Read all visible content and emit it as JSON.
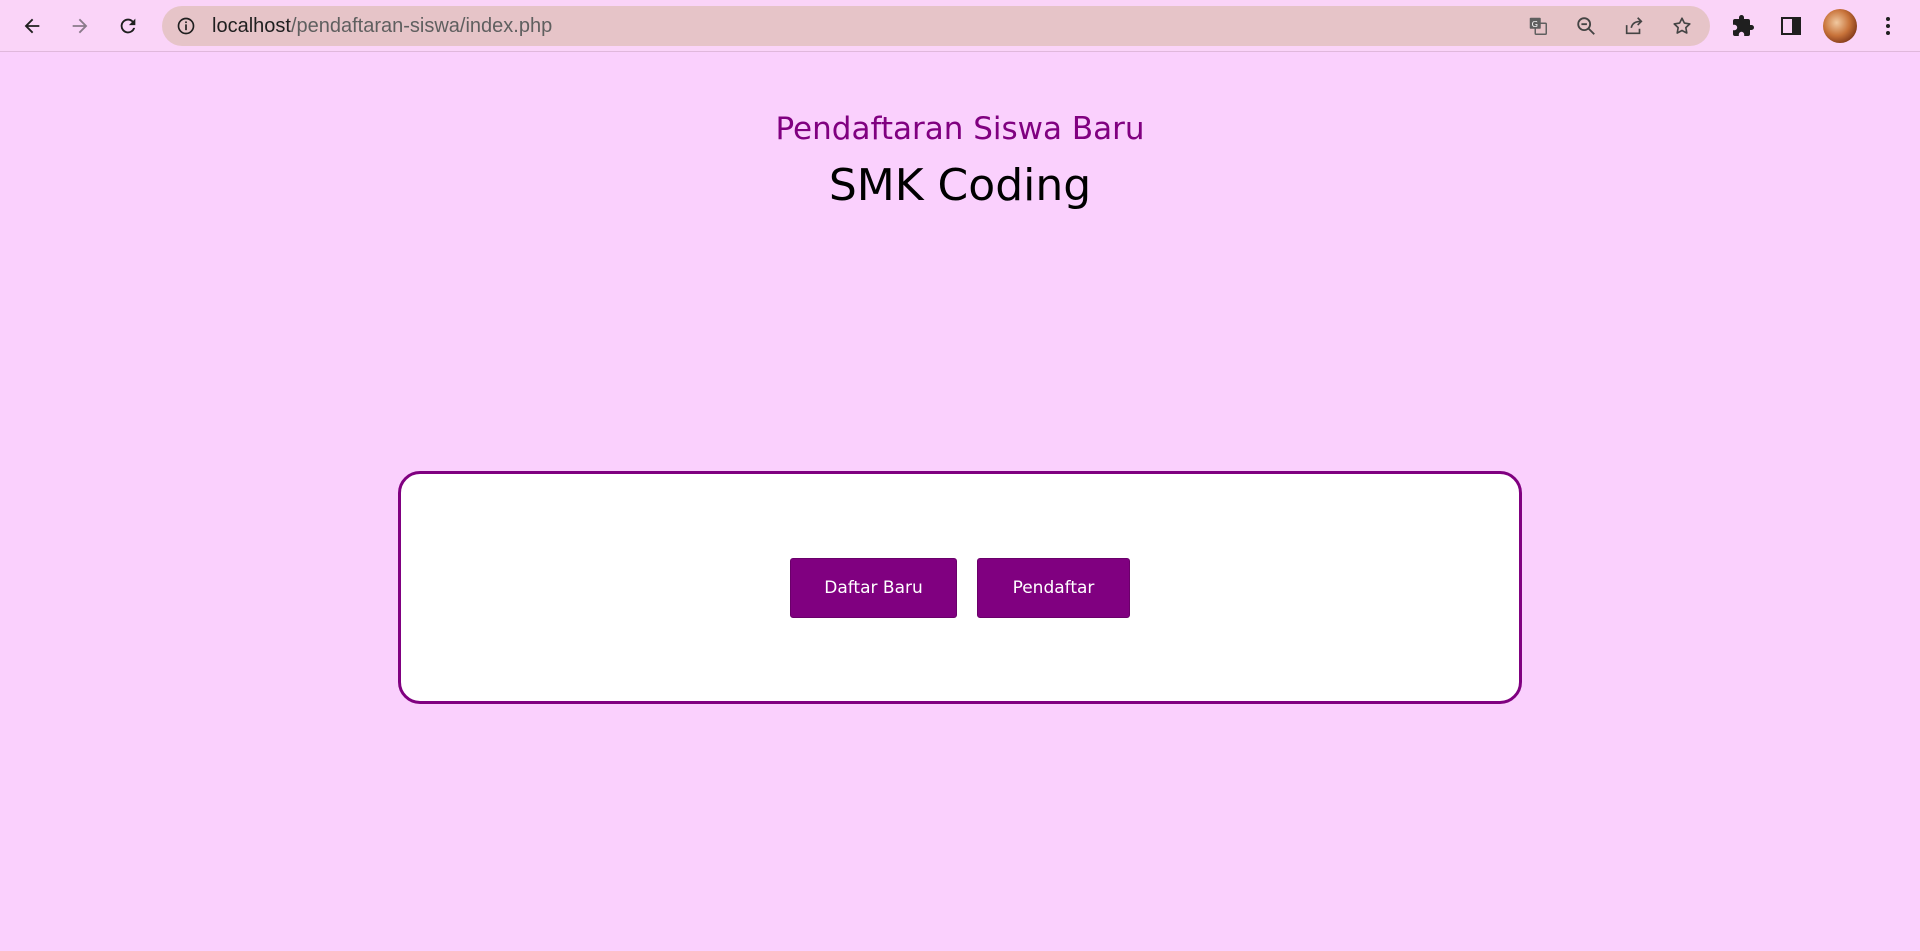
{
  "browser": {
    "url_host": "localhost",
    "url_path": "/pendaftaran-siswa/index.php"
  },
  "page": {
    "subtitle": "Pendaftaran Siswa Baru",
    "title": "SMK Coding",
    "buttons": {
      "daftar_baru": "Daftar Baru",
      "pendaftar": "Pendaftar"
    }
  },
  "colors": {
    "background": "#fad0fd",
    "accent": "#800080",
    "card": "#ffffff"
  },
  "icons": {
    "nav": [
      "back-arrow-icon",
      "forward-arrow-icon",
      "reload-icon"
    ],
    "omnibox": [
      "info-icon",
      "translate-icon",
      "zoom-out-icon",
      "share-icon",
      "bookmark-star-icon"
    ],
    "toolbar": [
      "extensions-icon",
      "side-panel-icon",
      "avatar",
      "menu-icon"
    ]
  }
}
